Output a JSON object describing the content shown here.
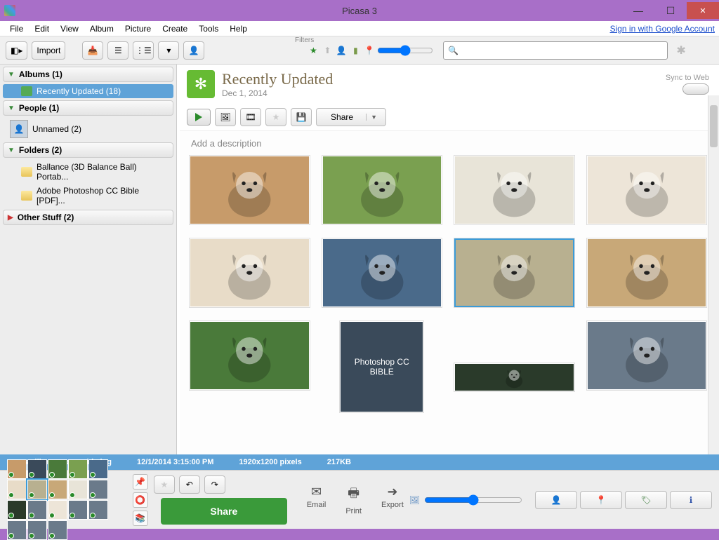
{
  "window": {
    "title": "Picasa 3",
    "signin_link": "Sign in with Google Account"
  },
  "menu": [
    "File",
    "Edit",
    "View",
    "Album",
    "Picture",
    "Create",
    "Tools",
    "Help"
  ],
  "toolbar": {
    "import_label": "Import",
    "filters_label": "Filters",
    "search_placeholder": ""
  },
  "sidebar": {
    "albums": {
      "header": "Albums (1)",
      "items": [
        {
          "label": "Recently Updated (18)"
        }
      ]
    },
    "people": {
      "header": "People (1)",
      "items": [
        {
          "label": "Unnamed (2)"
        }
      ]
    },
    "folders": {
      "header": "Folders (2)",
      "items": [
        {
          "label": "Ballance (3D Balance Ball) Portab..."
        },
        {
          "label": "Adobe Photoshop CC Bible [PDF]..."
        }
      ]
    },
    "other": {
      "header": "Other Stuff (2)"
    }
  },
  "album": {
    "title": "Recently Updated",
    "date": "Dec 1, 2014",
    "sync_label": "Sync to Web",
    "share_label": "Share",
    "description_placeholder": "Add a description"
  },
  "status": {
    "filename": "papillon_puppy-wide.jpg",
    "datetime": "12/1/2014 3:15:00 PM",
    "dimensions": "1920x1200 pixels",
    "filesize": "217KB"
  },
  "bottom": {
    "share_label": "Share",
    "email_label": "Email",
    "print_label": "Print",
    "export_label": "Export"
  },
  "thumbs": [
    {
      "id": "dog1",
      "bg": "#c79b6a"
    },
    {
      "id": "husky",
      "bg": "#7aa050"
    },
    {
      "id": "whitepup",
      "bg": "#e8e4d8"
    },
    {
      "id": "poodle",
      "bg": "#ede5d8"
    },
    {
      "id": "golden",
      "bg": "#e8dcc8"
    },
    {
      "id": "husky2",
      "bg": "#4a6a8a"
    },
    {
      "id": "papillon",
      "bg": "#b8b090",
      "selected": true
    },
    {
      "id": "sharpei",
      "bg": "#c8a878"
    },
    {
      "id": "pup-grass",
      "bg": "#4a7a3a"
    },
    {
      "id": "ps-bible",
      "bg": "#3a4a5a",
      "narrow": true,
      "text": "Photoshop CC BIBLE"
    },
    {
      "id": "banner",
      "bg": "#2a3a2a",
      "short": true
    },
    {
      "id": "game",
      "bg": "#6a7a8a"
    }
  ]
}
